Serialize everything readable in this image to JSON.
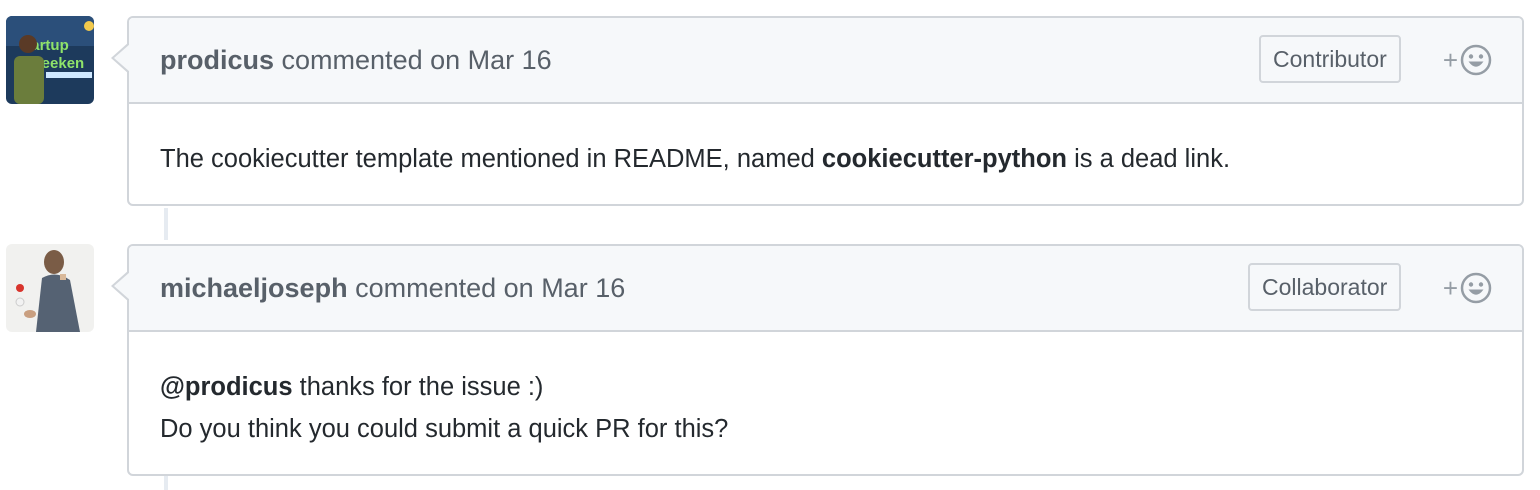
{
  "comments": [
    {
      "author": "prodicus",
      "meta": "commented on Mar 16",
      "role": "Contributor",
      "avatar_alt": "prodicus avatar",
      "body": {
        "text_before": "The cookiecutter template mentioned in README, named ",
        "bold": "cookiecutter-python",
        "text_after": " is a dead link."
      },
      "reaction_plus": "+"
    },
    {
      "author": "michaeljoseph",
      "meta": "commented on Mar 16",
      "role": "Collaborator",
      "avatar_alt": "michaeljoseph avatar",
      "body": {
        "mention": "@prodicus",
        "line1_after": " thanks for the issue :)",
        "line2": "Do you think you could submit a quick PR for this?"
      },
      "reaction_plus": "+"
    }
  ],
  "icons": {
    "reaction": "smiley-icon"
  },
  "colors": {
    "header_bg": "#f6f8fa",
    "border": "#d1d5da",
    "muted_text": "#586069",
    "body_text": "#24292e",
    "timeline": "#e6ebf1"
  }
}
